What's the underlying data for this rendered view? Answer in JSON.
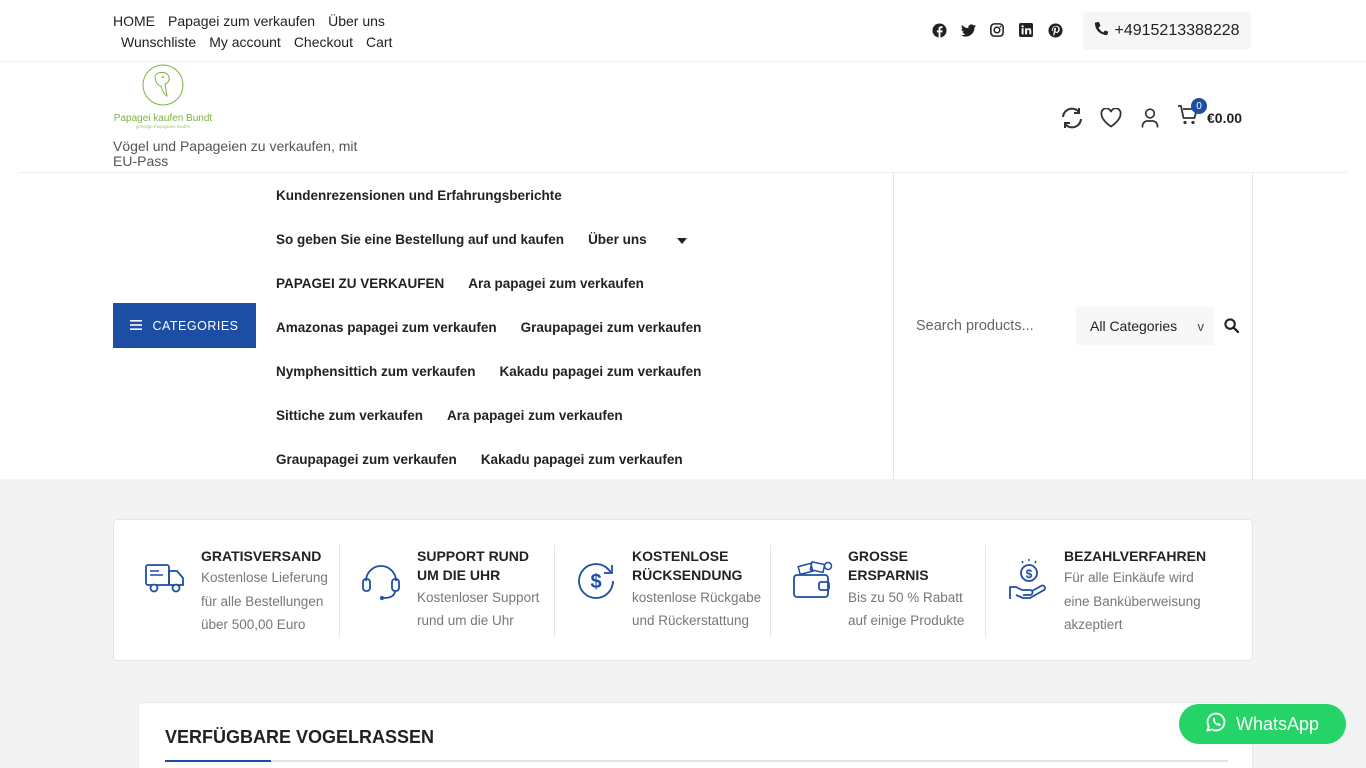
{
  "topbar": {
    "links_row1": [
      "HOME",
      "Papagei zum verkaufen",
      "Über uns"
    ],
    "links_row2": [
      "Wunschliste",
      "My account",
      "Checkout",
      "Cart"
    ],
    "social_icons": [
      "facebook-icon",
      "twitter-icon",
      "instagram-icon",
      "linkedin-icon",
      "pinterest-icon"
    ],
    "phone": "+4915213388228"
  },
  "header": {
    "logo_text": "Papagei kaufen Bundt",
    "logo_subtext": "günstige Papageien kaufen",
    "tagline": "Vögel und Papageien zu verkaufen, mit EU-Pass",
    "cart_count": "0",
    "cart_total": "€0.00"
  },
  "nav": {
    "categories_label": "CATEGORIES",
    "menu_rows": [
      [
        "Kundenrezensionen und Erfahrungsberichte"
      ],
      [
        "So geben Sie eine Bestellung auf und kaufen",
        "Über uns"
      ],
      [
        "PAPAGEI ZU VERKAUFEN",
        "Ara papagei zum verkaufen"
      ],
      [
        "Amazonas papagei zum verkaufen",
        "Graupapagei zum verkaufen"
      ],
      [
        "Nymphensittich zum verkaufen",
        "Kakadu papagei zum verkaufen"
      ],
      [
        "Sittiche zum verkaufen",
        "Ara papagei zum verkaufen"
      ],
      [
        "Graupapagei zum verkaufen",
        "Kakadu papagei zum verkaufen"
      ]
    ],
    "search_placeholder": "Search products...",
    "category_select": "All Categories",
    "select_arrow": "v"
  },
  "features": [
    {
      "icon": "truck-icon",
      "title": "GRATISVERSAND",
      "desc": [
        "Kostenlose Lieferung",
        "für alle Bestellungen",
        "über 500,00 Euro"
      ]
    },
    {
      "icon": "headset-icon",
      "title": "SUPPORT RUND UM DIE UHR",
      "desc": [
        "Kostenloser Support",
        "rund um die Uhr"
      ]
    },
    {
      "icon": "refund-dollar-icon",
      "title": "KOSTENLOSE RÜCKSENDUNG",
      "desc": [
        "kostenlose Rückgabe",
        "und Rückerstattung"
      ]
    },
    {
      "icon": "wallet-icon",
      "title": "GROSSE ERSPARNIS",
      "desc": [
        "Bis zu 50 % Rabatt",
        "auf einige Produkte"
      ]
    },
    {
      "icon": "hand-money-icon",
      "title": "BEZAHLVERFAHREN",
      "desc": [
        "Für alle Einkäufe wird",
        "eine Banküberweisung",
        "akzeptiert"
      ]
    }
  ],
  "breeds": {
    "title": "VERFÜGBARE VOGELRASSEN"
  },
  "whatsapp": {
    "label": "WhatsApp"
  },
  "colors": {
    "accent": "#1d4ea3",
    "whatsapp": "#25d366",
    "logo": "#7cb342"
  }
}
